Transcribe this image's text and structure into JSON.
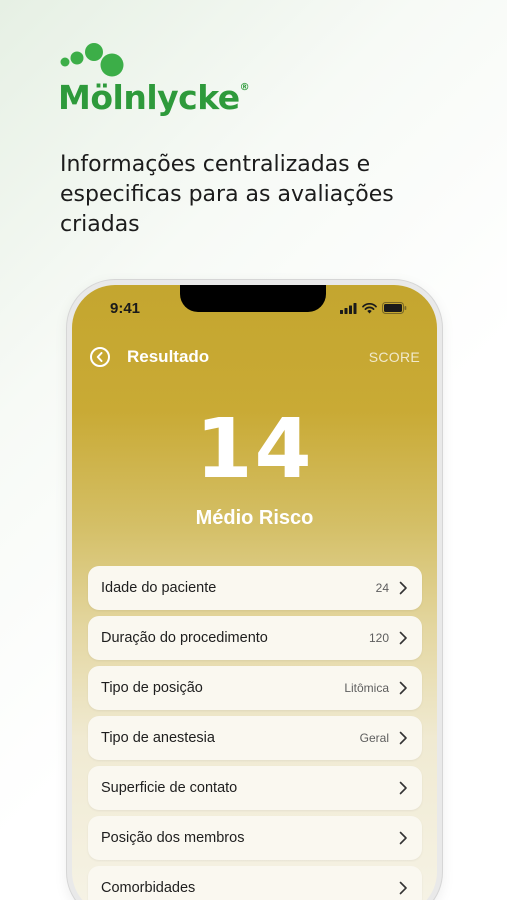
{
  "brand": {
    "name": "Mölnlycke",
    "registered": "®",
    "color": "#2e9a3b"
  },
  "tagline": "Informações centralizadas e especificas para as avaliações criadas",
  "status_bar": {
    "time": "9:41"
  },
  "header": {
    "title": "Resultado",
    "action_label": "SCORE",
    "back_icon": "back-circle-icon"
  },
  "result": {
    "score": "14",
    "risk_label": "Médio Risco"
  },
  "items": [
    {
      "label": "Idade do paciente",
      "value": "24"
    },
    {
      "label": "Duração do procedimento",
      "value": "120"
    },
    {
      "label": "Tipo de posição",
      "value": "Litômica"
    },
    {
      "label": "Tipo de anestesia",
      "value": "Geral"
    },
    {
      "label": "Superficie de contato",
      "value": ""
    },
    {
      "label": "Posição dos membros",
      "value": ""
    },
    {
      "label": "Comorbidades",
      "value": ""
    }
  ],
  "colors": {
    "header_gold": "#c4a62f",
    "card_bg": "#faf8f0"
  }
}
